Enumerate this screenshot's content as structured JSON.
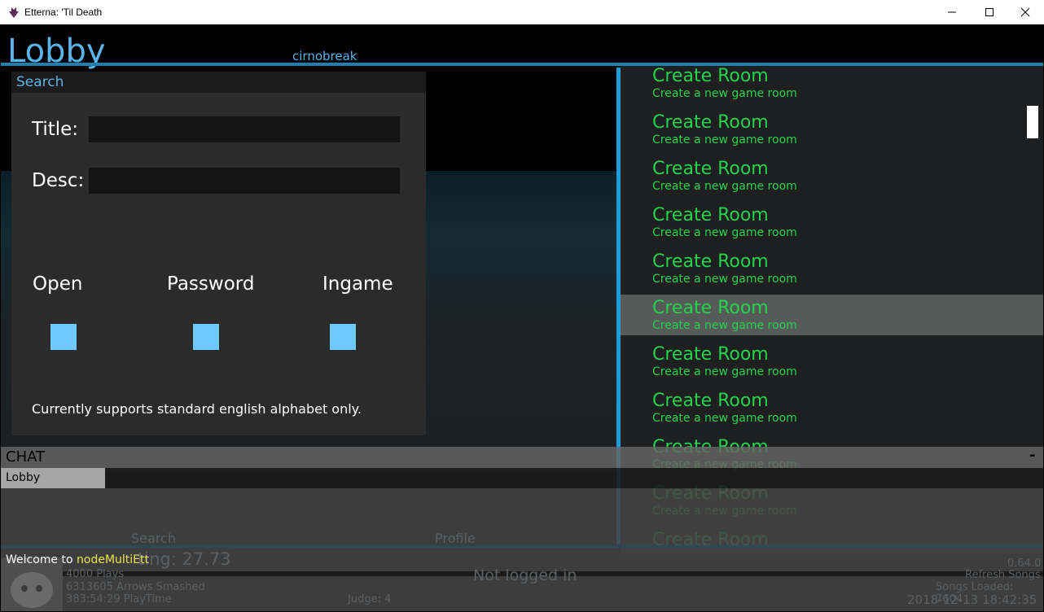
{
  "window": {
    "title": "Etterna: 'Til Death"
  },
  "header": {
    "title": "Lobby",
    "username": "cirnobreak"
  },
  "search": {
    "title": "Search",
    "title_label": "Title:",
    "desc_label": "Desc:",
    "title_value": "",
    "desc_value": "",
    "filters": [
      "Open",
      "Password",
      "Ingame"
    ],
    "note": "Currently supports standard english alphabet only."
  },
  "rooms": {
    "name": "Create Room",
    "description": "Create a new game room",
    "highlighted_index": 5
  },
  "chat": {
    "title": "CHAT",
    "minimize": "-",
    "tab": "Lobby",
    "message_prefix": "Welcome to ",
    "message_highlight": "nodeMultiEtt"
  },
  "background": {
    "search_tab": "Search",
    "profile_tab": "Profile",
    "rating": "ting: 27.73",
    "plays": "4000 Plays",
    "arrows": "6313605 Arrows Smashed",
    "playtime": "383:54:29 PlayTime",
    "judge": "Judge: 4",
    "login": "Not logged in",
    "version": "0.64.0",
    "refresh": "Refresh Songs",
    "songs_loaded": "Songs Loaded: 7604",
    "datetime": "2018-12-13 18:42:35"
  },
  "colors": {
    "accent": "#5ab4e8",
    "room_text": "#22d44c",
    "checkbox": "#6ecaff",
    "highlight_text": "#e8e84a"
  }
}
